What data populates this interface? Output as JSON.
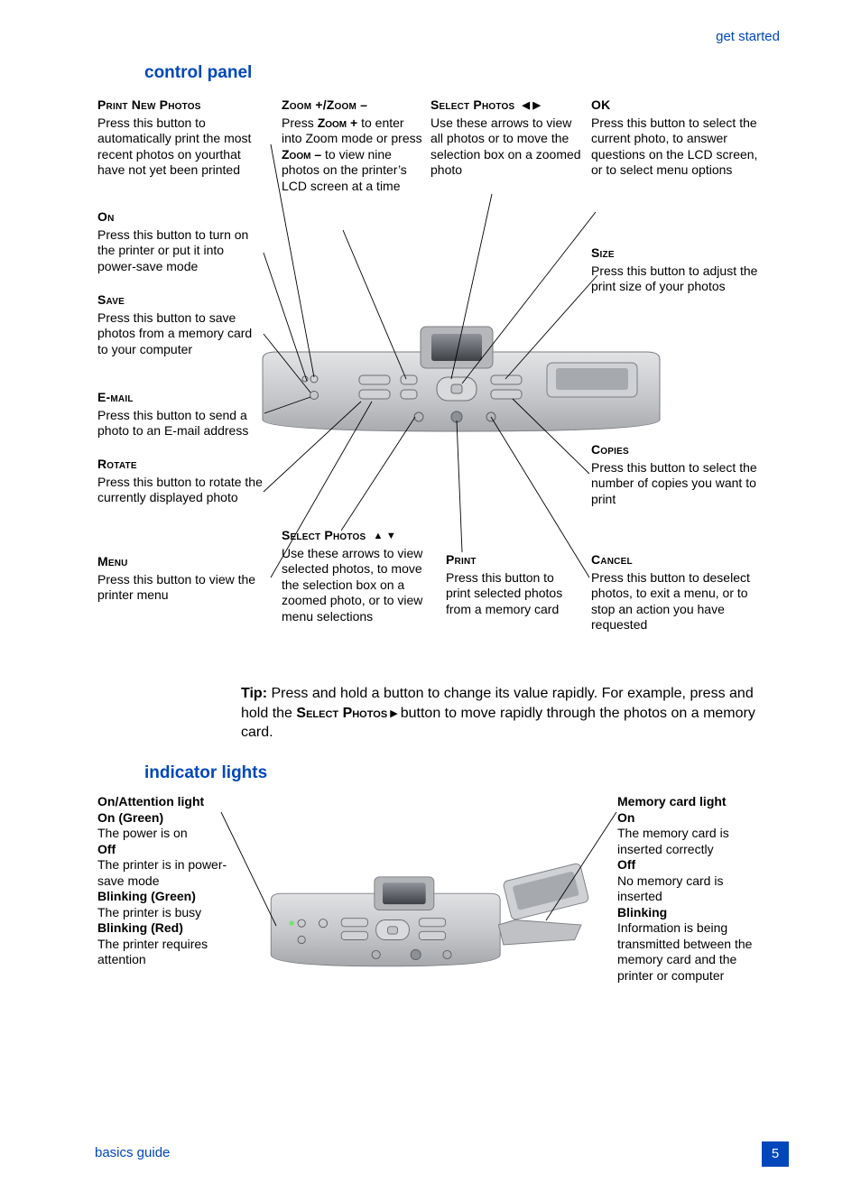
{
  "header_link": "get started",
  "section1_title": "control panel",
  "callouts": {
    "print_new_photos": {
      "head": "Print New Photos",
      "body": "Press this button to automatically print the most recent photos on yourthat have not yet been printed"
    },
    "on": {
      "head": "On",
      "body": "Press this button to turn on the printer or put it into power-save mode"
    },
    "save": {
      "head": "Save",
      "body": "Press this button to save photos from a memory card to your computer"
    },
    "email": {
      "head": "E-mail",
      "body": "Press this button to send a photo to an E-mail address"
    },
    "rotate": {
      "head": "Rotate",
      "body": "Press this button to rotate the currently displayed photo"
    },
    "menu": {
      "head": "Menu",
      "body": "Press this button to view the printer menu"
    },
    "zoom": {
      "head": "Zoom +/Zoom –",
      "body_pre": "Press ",
      "z1": "Zoom +",
      "body_mid": " to enter into Zoom mode or press ",
      "z2": "Zoom –",
      "body_post": " to view nine photos on the printer’s LCD screen at a time"
    },
    "sel_lr": {
      "head": "Select Photos",
      "arrows": "◀ ▶",
      "body": "Use these arrows to view all photos or to move the selection box on a zoomed photo"
    },
    "ok": {
      "head": "OK",
      "body": "Press this button to select the current photo, to answer questions on the LCD screen, or to select menu options"
    },
    "size": {
      "head": "Size",
      "body": "Press this button to adjust the print size of your photos"
    },
    "copies": {
      "head": "Copies",
      "body": "Press this button to select the number of copies you want to print"
    },
    "sel_ud": {
      "head": "Select Photos",
      "arrows": "▲ ▼",
      "body": "Use these arrows to view selected photos, to move the selection box on a zoomed photo, or to view menu selections"
    },
    "print": {
      "head": "Print",
      "body": "Press this button to print selected photos from a memory card"
    },
    "cancel": {
      "head": "Cancel",
      "body": "Press this button to deselect photos, to exit a menu, or to stop an action you have requested"
    }
  },
  "tip": {
    "label": "Tip:",
    "pre": "  Press and hold a button to change its value rapidly. For example, press and hold the ",
    "sc": "Select Photos",
    "arrow": " ▶ ",
    "post": "button to move rapidly through the photos on a memory card."
  },
  "section2_title": "indicator lights",
  "ind_left": {
    "t1": "On/Attention light",
    "s1": "On (Green)",
    "b1": "The power is on",
    "s2": "Off",
    "b2": "The printer is in power-save mode",
    "s3": "Blinking (Green)",
    "b3": "The printer is busy",
    "s4": "Blinking (Red)",
    "b4": "The printer requires attention"
  },
  "ind_right": {
    "t1": "Memory card light",
    "s1": "On",
    "b1": "The memory card is inserted correctly",
    "s2": "Off",
    "b2": "No memory card is inserted",
    "s3": "Blinking",
    "b3": "Information is being transmitted between the memory card and the printer or computer"
  },
  "footer_left": "basics guide",
  "page_number": "5"
}
